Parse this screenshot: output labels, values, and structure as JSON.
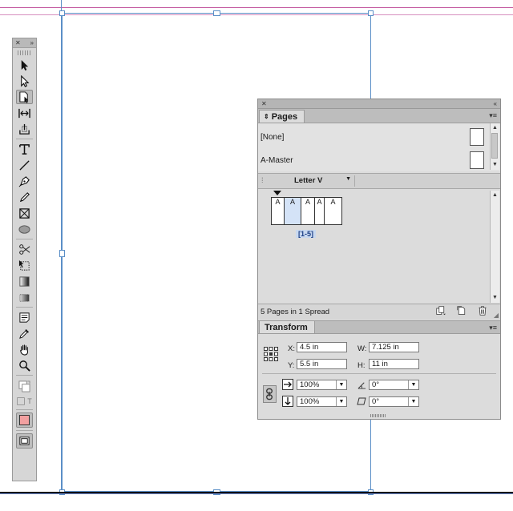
{
  "tools_panel": {
    "close_glyph": "✕",
    "collapse_glyph": "»",
    "tools": [
      {
        "name": "selection-tool-icon"
      },
      {
        "name": "direct-selection-tool-icon"
      },
      {
        "name": "page-tool-icon",
        "active": true
      },
      {
        "name": "gap-tool-icon"
      },
      {
        "name": "content-collector-tool-icon"
      },
      {
        "name": "type-tool-icon"
      },
      {
        "name": "line-tool-icon"
      },
      {
        "name": "pen-tool-icon"
      },
      {
        "name": "pencil-tool-icon"
      },
      {
        "name": "rectangle-frame-tool-icon"
      },
      {
        "name": "ellipse-tool-icon"
      },
      {
        "name": "scissors-tool-icon"
      },
      {
        "name": "free-transform-tool-icon"
      },
      {
        "name": "gradient-swatch-tool-icon"
      },
      {
        "name": "gradient-feather-tool-icon"
      },
      {
        "name": "note-tool-icon"
      },
      {
        "name": "eyedropper-tool-icon"
      },
      {
        "name": "hand-tool-icon"
      },
      {
        "name": "zoom-tool-icon"
      }
    ],
    "fill_color": "#f2a0a0",
    "fill_stroke_label": "T"
  },
  "pages_panel": {
    "tab_label": "Pages",
    "masters": [
      {
        "label": "[None]"
      },
      {
        "label": "A-Master"
      }
    ],
    "page_size_label": "Letter V",
    "pages": [
      "A",
      "A",
      "A",
      "A",
      "A"
    ],
    "selected_page_index": 1,
    "spread_label": "[1-5]",
    "status_text": "5 Pages in 1 Spread"
  },
  "transform_panel": {
    "tab_label": "Transform",
    "x_label": "X:",
    "x_value": "4.5 in",
    "y_label": "Y:",
    "y_value": "5.5 in",
    "w_label": "W:",
    "w_value": "7.125 in",
    "h_label": "H:",
    "h_value": "11 in",
    "scale_x": "100%",
    "scale_y": "100%",
    "rotate": "0°",
    "shear": "0°"
  },
  "colors": {
    "guide": "#c45aa0",
    "frame": "#5b8fc7",
    "selection_blue": "#d4e3f7"
  }
}
